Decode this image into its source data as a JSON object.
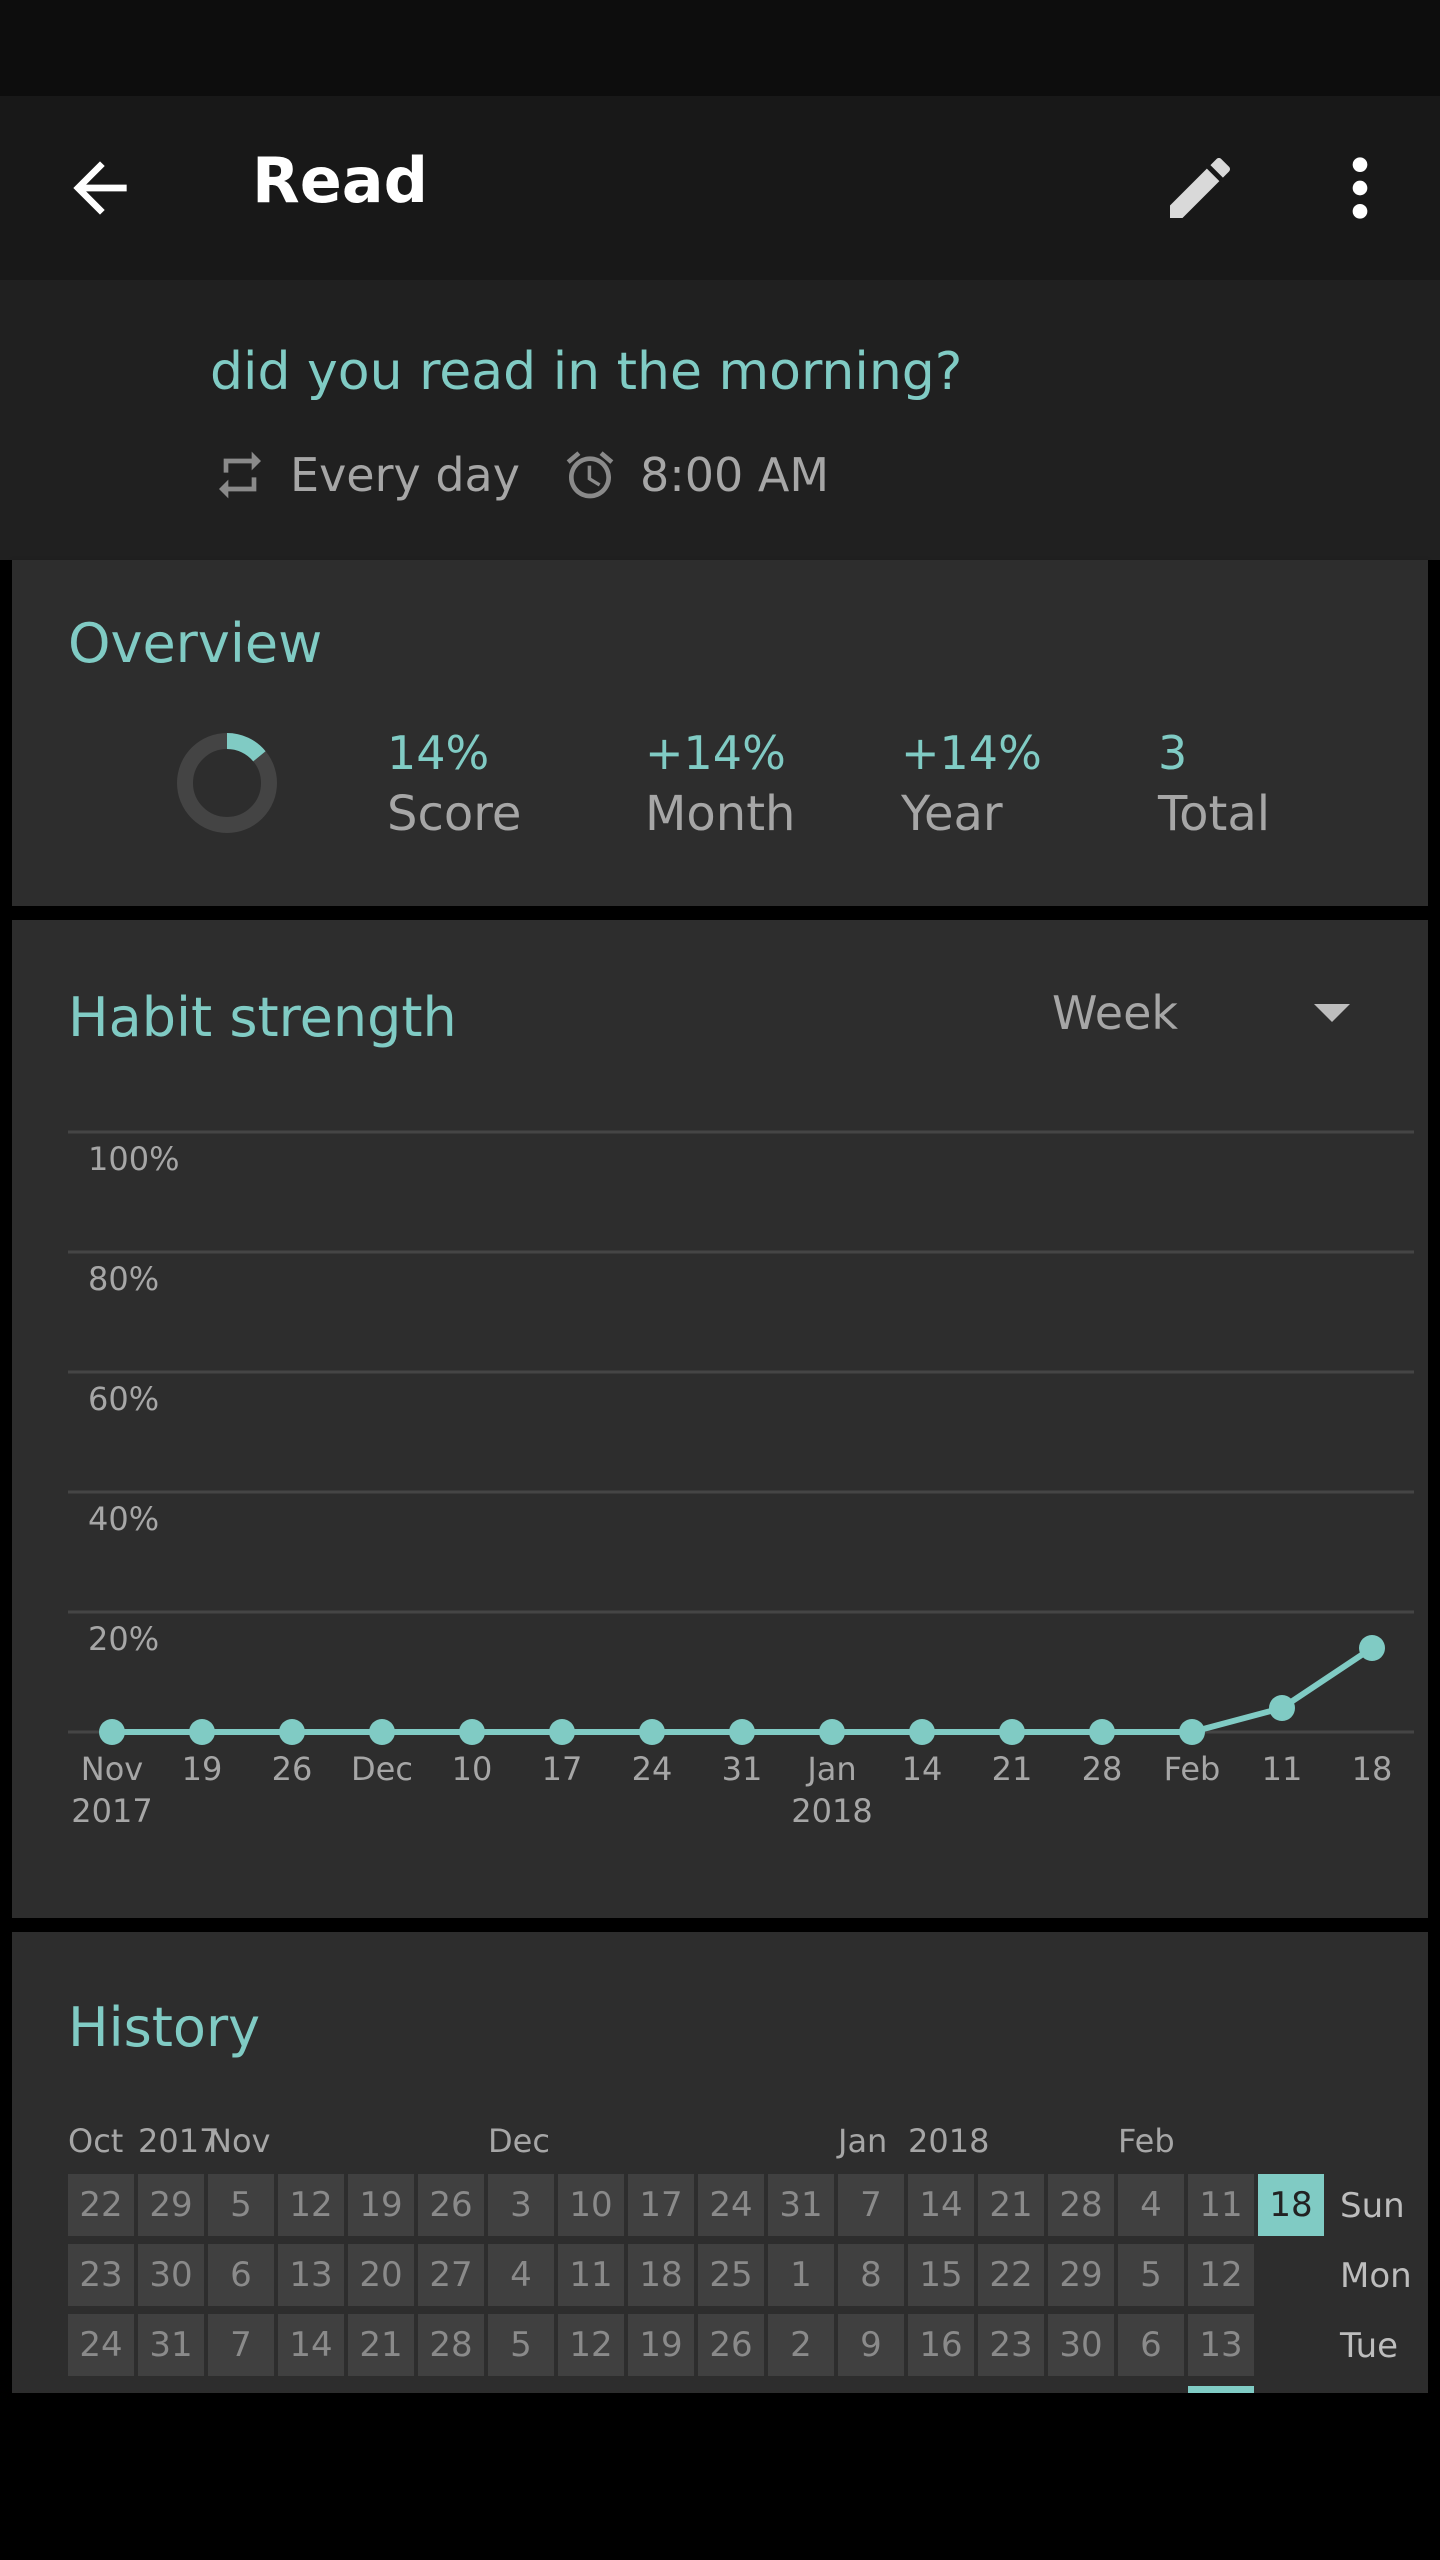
{
  "appbar": {
    "title": "Read",
    "back_icon": "arrow-back-icon",
    "edit_icon": "pencil-icon",
    "more_icon": "more-vert-icon"
  },
  "header": {
    "question": "did you read in the morning?",
    "frequency": "Every day",
    "reminder": "8:00 AM"
  },
  "overview": {
    "title": "Overview",
    "score_fraction": 0.14,
    "stats": [
      {
        "value": "14%",
        "label": "Score"
      },
      {
        "value": "+14%",
        "label": "Month"
      },
      {
        "value": "+14%",
        "label": "Year"
      },
      {
        "value": "3",
        "label": "Total"
      }
    ]
  },
  "habit_strength": {
    "title": "Habit strength",
    "period": "Week"
  },
  "chart_data": {
    "type": "line",
    "y_ticks": [
      "100%",
      "80%",
      "60%",
      "40%",
      "20%"
    ],
    "ylim": [
      0,
      100
    ],
    "x_labels": [
      {
        "top": "Nov",
        "bottom": "2017"
      },
      {
        "top": "19"
      },
      {
        "top": "26"
      },
      {
        "top": "Dec"
      },
      {
        "top": "10"
      },
      {
        "top": "17"
      },
      {
        "top": "24"
      },
      {
        "top": "31"
      },
      {
        "top": "Jan",
        "bottom": "2018"
      },
      {
        "top": "14"
      },
      {
        "top": "21"
      },
      {
        "top": "28"
      },
      {
        "top": "Feb"
      },
      {
        "top": "11"
      },
      {
        "top": "18"
      }
    ],
    "values": [
      0,
      0,
      0,
      0,
      0,
      0,
      0,
      0,
      0,
      0,
      0,
      0,
      0,
      4,
      14
    ],
    "color": "#80cbc4"
  },
  "history": {
    "title": "History",
    "months": [
      {
        "label": "Oct",
        "col": 0
      },
      {
        "label": "2017",
        "col": 1
      },
      {
        "label": "Nov",
        "col": 2
      },
      {
        "label": "Dec",
        "col": 6
      },
      {
        "label": "Jan",
        "col": 11
      },
      {
        "label": "2018",
        "col": 12
      },
      {
        "label": "Feb",
        "col": 15
      }
    ],
    "weekdays": [
      "Sun",
      "Mon",
      "Tue"
    ],
    "rows": [
      [
        "22",
        "29",
        "5",
        "12",
        "19",
        "26",
        "3",
        "10",
        "17",
        "24",
        "31",
        "7",
        "14",
        "21",
        "28",
        "4",
        "11",
        "18"
      ],
      [
        "23",
        "30",
        "6",
        "13",
        "20",
        "27",
        "4",
        "11",
        "18",
        "25",
        "1",
        "8",
        "15",
        "22",
        "29",
        "5",
        "12",
        ""
      ],
      [
        "24",
        "31",
        "7",
        "14",
        "21",
        "28",
        "5",
        "12",
        "19",
        "26",
        "2",
        "9",
        "16",
        "23",
        "30",
        "6",
        "13",
        ""
      ]
    ],
    "today": "18"
  },
  "accent_color": "#80cbc4"
}
